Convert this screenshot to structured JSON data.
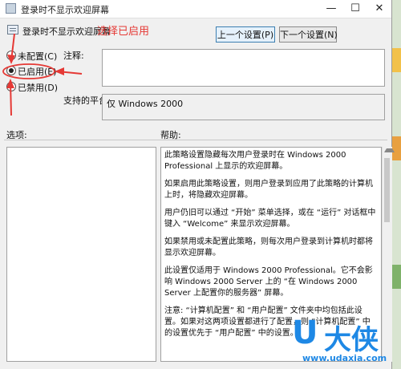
{
  "window": {
    "title": "登录时不显示欢迎屏幕"
  },
  "header": {
    "policy_name": "登录时不显示欢迎屏幕",
    "annotation": "选择已启用"
  },
  "nav": {
    "prev_label": "上一个设置(P)",
    "next_label": "下一个设置(N)"
  },
  "state": {
    "options": [
      {
        "label": "未配置(C)",
        "selected": false
      },
      {
        "label": "已启用(E)",
        "selected": true
      },
      {
        "label": "已禁用(D)",
        "selected": false
      }
    ]
  },
  "fields": {
    "comment_label": "注释:",
    "comment_value": "",
    "platform_label": "支持的平台:",
    "platform_value": "仅 Windows 2000",
    "options_label": "选项:",
    "help_label": "帮助:"
  },
  "help_paragraphs": [
    "此策略设置隐藏每次用户登录时在 Windows 2000 Professional 上显示的欢迎屏幕。",
    "如果启用此策略设置，则用户登录到应用了此策略的计算机上时，将隐藏欢迎屏幕。",
    "用户仍旧可以通过 “开始” 菜单选择，或在 “运行” 对话框中键入 “Welcome” 来显示欢迎屏幕。",
    "如果禁用或未配置此策略，则每次用户登录到计算机时都将显示欢迎屏幕。",
    "此设置仅适用于 Windows 2000 Professional。它不会影响 Windows 2000 Server 上的 “在 Windows 2000 Server 上配置你的服务器” 屏幕。",
    "注意: “计算机配置” 和 “用户配置” 文件夹中均包括此设置。如果对这两项设置都进行了配置，则 “计算机配置” 中的设置优先于 “用户配置” 中的设置。"
  ],
  "watermark": {
    "u": "U",
    "cn": "大侠",
    "url": "www.udaxia.com"
  },
  "colors": {
    "annotation": "#e53935",
    "watermark": "#1e88e5",
    "primary_button_border": "#3c7fb1"
  },
  "icons": [
    "policy-icon",
    "minimize-icon",
    "maximize-icon",
    "close-icon",
    "annotation-arrow-icon"
  ]
}
